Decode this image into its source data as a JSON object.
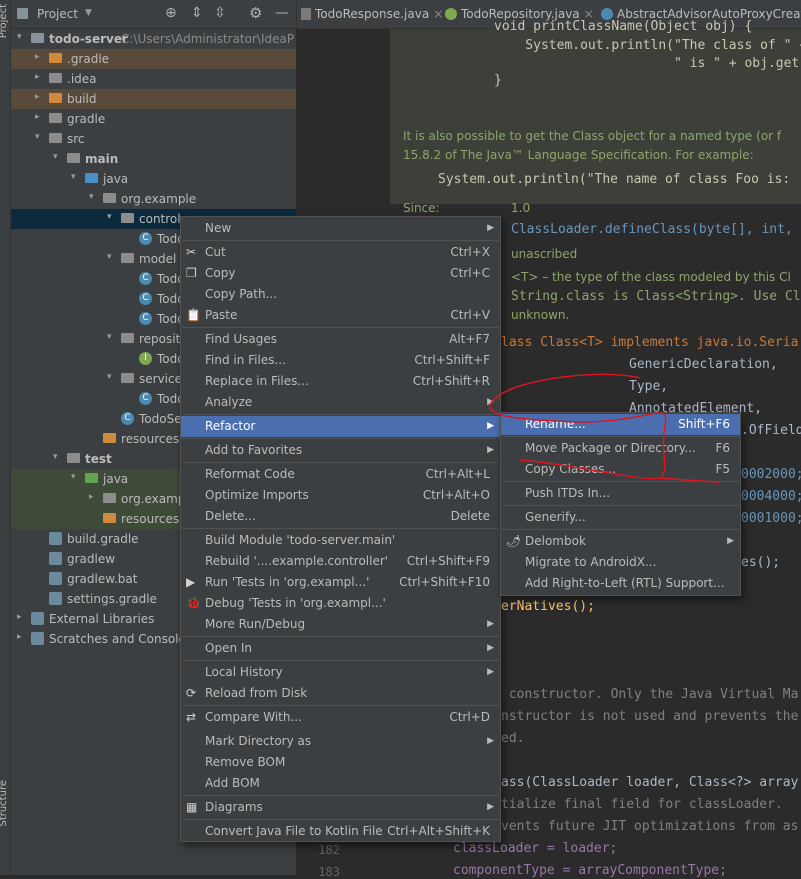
{
  "left_strip": {
    "project_label": "Project",
    "structure_label": "Structure"
  },
  "project_panel": {
    "title": "Project",
    "tree": [
      {
        "label": "todo-server",
        "note": "C:\\Users\\Administrator\\IdeaP"
      },
      {
        "label": ".gradle"
      },
      {
        "label": ".idea"
      },
      {
        "label": "build"
      },
      {
        "label": "gradle"
      },
      {
        "label": "src"
      },
      {
        "label": "main"
      },
      {
        "label": "java"
      },
      {
        "label": "org.example"
      },
      {
        "label": "control"
      },
      {
        "label": "Todo"
      },
      {
        "label": "model"
      },
      {
        "label": "Todo"
      },
      {
        "label": "Todo"
      },
      {
        "label": "Todo"
      },
      {
        "label": "reposit"
      },
      {
        "label": "Todo"
      },
      {
        "label": "service"
      },
      {
        "label": "Todo"
      },
      {
        "label": "TodoSe"
      },
      {
        "label": "resources"
      },
      {
        "label": "test"
      },
      {
        "label": "java"
      },
      {
        "label": "org.examp"
      },
      {
        "label": "resources"
      },
      {
        "label": "build.gradle"
      },
      {
        "label": "gradlew"
      },
      {
        "label": "gradlew.bat"
      },
      {
        "label": "settings.gradle"
      },
      {
        "label": "External Libraries"
      },
      {
        "label": "Scratches and Consoles"
      }
    ]
  },
  "tabs": [
    {
      "label": "TodoResponse.java"
    },
    {
      "label": "TodoRepository.java"
    },
    {
      "label": "AbstractAdvisorAutoProxyCreator."
    }
  ],
  "doc": {
    "code1": "void printClassName(Object obj) {",
    "code2": "    System.out.println(\"The class of \" +",
    "code3": "                       \" is \" + obj.get",
    "code4": "}",
    "para1a": "It is also possible to get the Class object for a named type (or f",
    "para1b": "15.8.2 of The Java™ Language Specification. For example:",
    "code5": "System.out.println(\"The name of class Foo is: ",
    "since_label": "Since:",
    "since_value": "1.0"
  },
  "editor_code": [
    "ClassLoader.defineClass(byte[], int, i",
    "unascribed",
    "<T> – the type of the class modeled by this Cl",
    "String.class is Class<String>. Use Class",
    "unknown.",
    "lass Class<T> implements java.io.Seria",
    "GenericDeclaration,",
    "Type,",
    "AnnotatedElement,",
    ".OfField",
    "0002000;",
    "0004000;",
    "0001000;",
    "es();",
    "erNatives();",
    " constructor. Only the Java Virtual Ma",
    "nstructor is not used and prevents the",
    "ed.",
    "ass(ClassLoader loader, Class<?> array",
    "tialize final field for classLoader.",
    "vents future JIT optimizations from as",
    "classLoader = loader;",
    "componentType = arrayComponentType;"
  ],
  "line_numbers": [
    "182",
    "183"
  ],
  "context_menu": [
    {
      "label": "New",
      "shortcut": "",
      "submenu": true
    },
    {
      "label": "Cut",
      "shortcut": "Ctrl+X",
      "icon": "✂"
    },
    {
      "label": "Copy",
      "shortcut": "Ctrl+C",
      "icon": "❐"
    },
    {
      "label": "Copy Path...",
      "shortcut": ""
    },
    {
      "label": "Paste",
      "shortcut": "Ctrl+V",
      "icon": "📋"
    },
    {
      "label": "Find Usages",
      "shortcut": "Alt+F7"
    },
    {
      "label": "Find in Files...",
      "shortcut": "Ctrl+Shift+F"
    },
    {
      "label": "Replace in Files...",
      "shortcut": "Ctrl+Shift+R"
    },
    {
      "label": "Analyze",
      "shortcut": "",
      "submenu": true
    },
    {
      "label": "Refactor",
      "shortcut": "",
      "submenu": true
    },
    {
      "label": "Add to Favorites",
      "shortcut": "",
      "submenu": true
    },
    {
      "label": "Reformat Code",
      "shortcut": "Ctrl+Alt+L"
    },
    {
      "label": "Optimize Imports",
      "shortcut": "Ctrl+Alt+O"
    },
    {
      "label": "Delete...",
      "shortcut": "Delete"
    },
    {
      "label": "Build Module 'todo-server.main'",
      "shortcut": ""
    },
    {
      "label": "Rebuild '....example.controller'",
      "shortcut": "Ctrl+Shift+F9"
    },
    {
      "label": "Run 'Tests in 'org.exampl...'",
      "shortcut": "Ctrl+Shift+F10",
      "icon": "▶"
    },
    {
      "label": "Debug 'Tests in 'org.exampl...'",
      "shortcut": "",
      "icon": "🐞"
    },
    {
      "label": "More Run/Debug",
      "shortcut": "",
      "submenu": true
    },
    {
      "label": "Open In",
      "shortcut": "",
      "submenu": true
    },
    {
      "label": "Local History",
      "shortcut": "",
      "submenu": true
    },
    {
      "label": "Reload from Disk",
      "shortcut": "",
      "icon": "⟳"
    },
    {
      "label": "Compare With...",
      "shortcut": "Ctrl+D",
      "icon": "⇄"
    },
    {
      "label": "Mark Directory as",
      "shortcut": "",
      "submenu": true
    },
    {
      "label": "Remove BOM",
      "shortcut": ""
    },
    {
      "label": "Add BOM",
      "shortcut": ""
    },
    {
      "label": "Diagrams",
      "shortcut": "",
      "submenu": true,
      "icon": "▦"
    },
    {
      "label": "Convert Java File to Kotlin File",
      "shortcut": "Ctrl+Alt+Shift+K"
    }
  ],
  "refactor_submenu": [
    {
      "label": "Rename...",
      "shortcut": "Shift+F6"
    },
    {
      "label": "Move Package or Directory...",
      "shortcut": "F6"
    },
    {
      "label": "Copy Classes...",
      "shortcut": "F5"
    },
    {
      "label": "Push ITDs In...",
      "shortcut": ""
    },
    {
      "label": "Generify...",
      "shortcut": ""
    },
    {
      "label": "Delombok",
      "shortcut": "",
      "submenu": true,
      "icon": "🌶"
    },
    {
      "label": "Migrate to AndroidX...",
      "shortcut": ""
    },
    {
      "label": "Add Right-to-Left (RTL) Support...",
      "shortcut": ""
    }
  ],
  "colors": {
    "selection": "#4b6eaf",
    "annotation": "#e0141e",
    "menu_bg": "#3c3f41"
  }
}
